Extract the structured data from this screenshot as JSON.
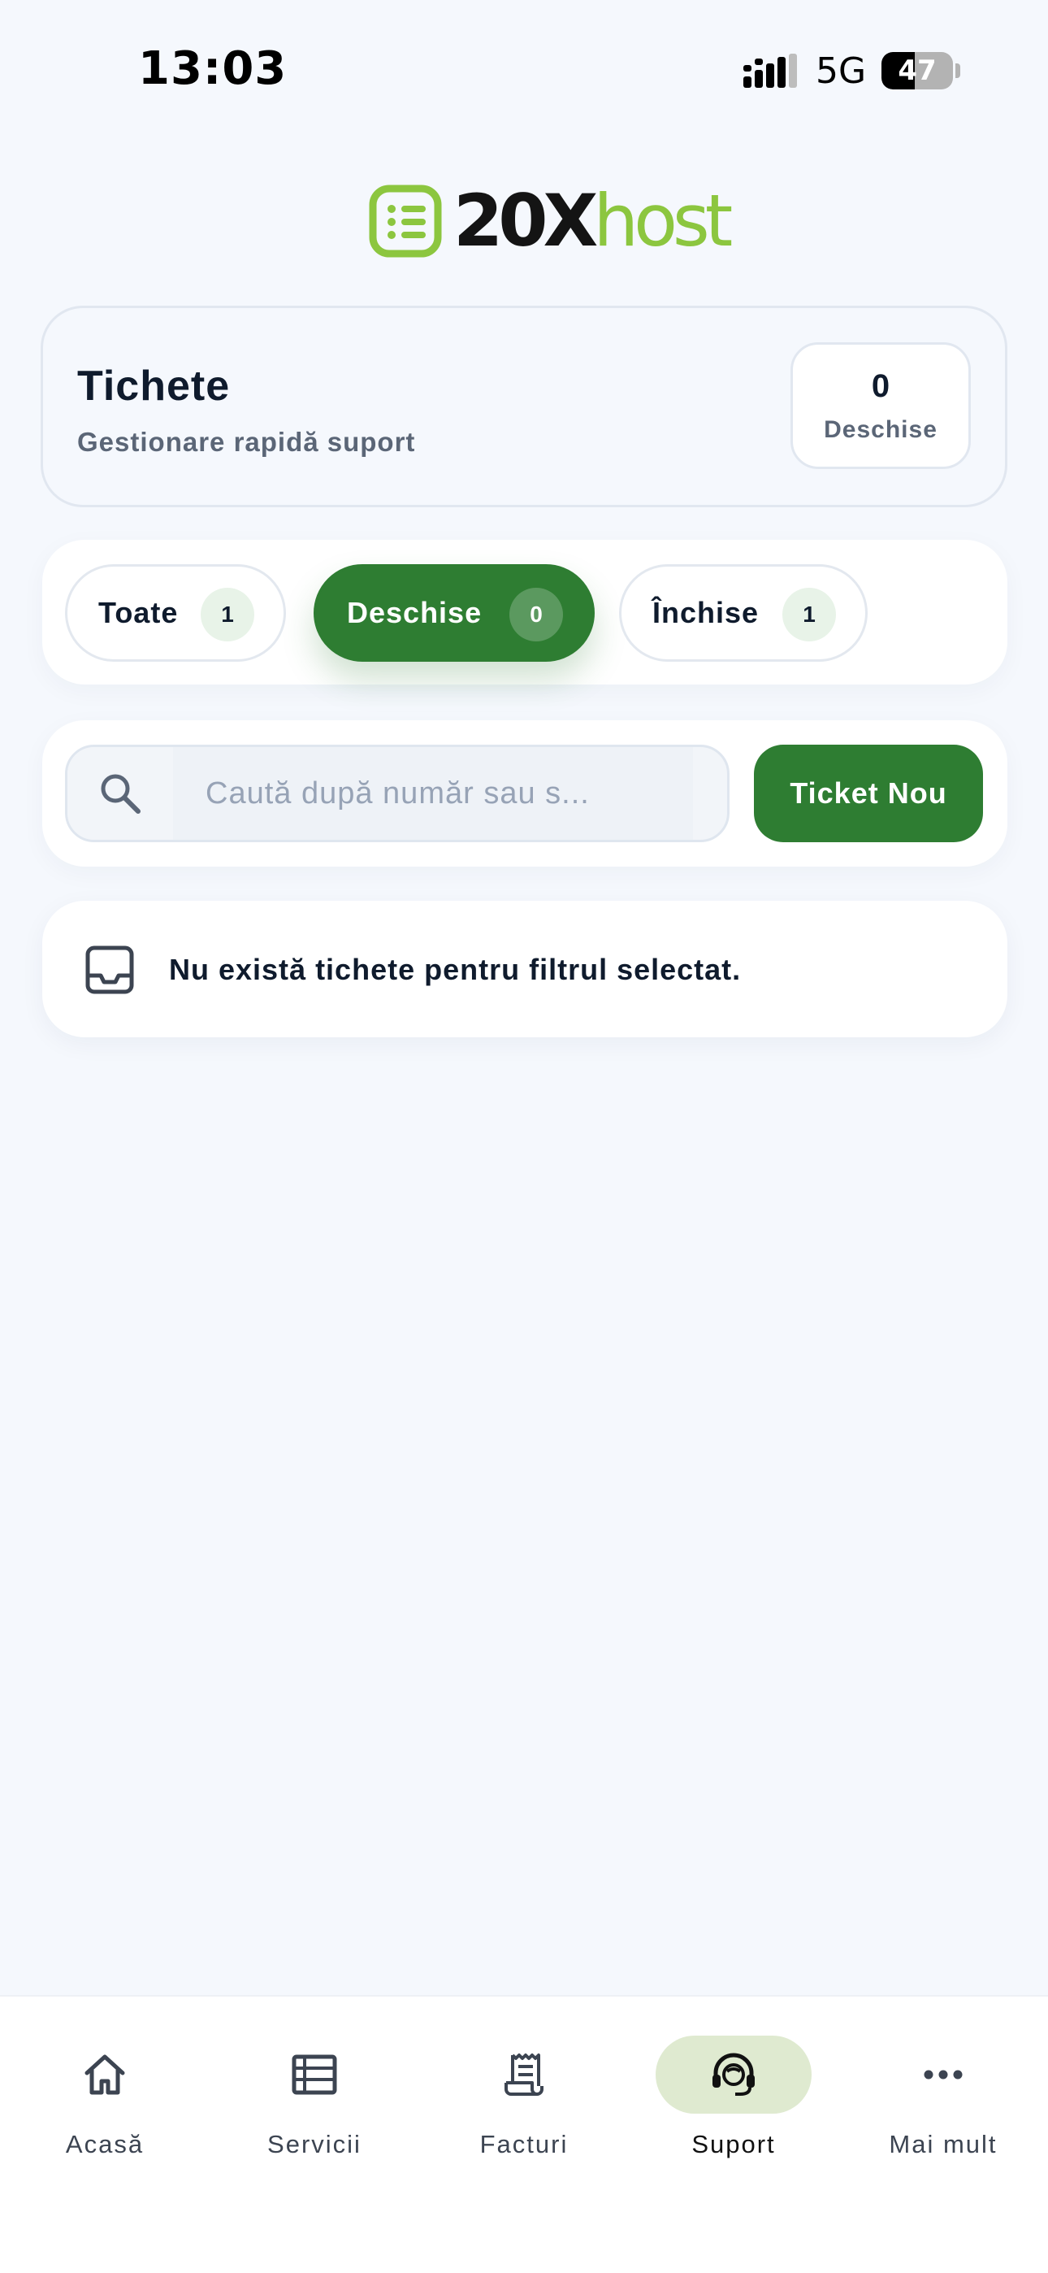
{
  "status_bar": {
    "time": "13:03",
    "network": "5G",
    "battery": "47",
    "battery_level": 0.47
  },
  "brand": {
    "logo_text_dark": "20X",
    "logo_text_green": "host",
    "green": "#8cc63f",
    "accent": "#2e7d32"
  },
  "header": {
    "title": "Tichete",
    "subtitle": "Gestionare rapidă suport",
    "open_count": "0",
    "open_label": "Deschise"
  },
  "filters": [
    {
      "label": "Toate",
      "count": "1",
      "active": false
    },
    {
      "label": "Deschise",
      "count": "0",
      "active": true
    },
    {
      "label": "Închise",
      "count": "1",
      "active": false
    }
  ],
  "search": {
    "placeholder": "Caută după număr sau s...",
    "value": "",
    "icon": "search-icon"
  },
  "new_ticket_label": "Ticket Nou",
  "empty_state": {
    "icon": "inbox-icon",
    "message": "Nu există tichete pentru filtrul selectat."
  },
  "bottom_nav": [
    {
      "label": "Acasă",
      "icon": "home-icon",
      "active": false
    },
    {
      "label": "Servicii",
      "icon": "list-icon",
      "active": false
    },
    {
      "label": "Facturi",
      "icon": "receipt-icon",
      "active": false
    },
    {
      "label": "Suport",
      "icon": "headset-icon",
      "active": true
    },
    {
      "label": "Mai mult",
      "icon": "more-icon",
      "active": false
    }
  ]
}
